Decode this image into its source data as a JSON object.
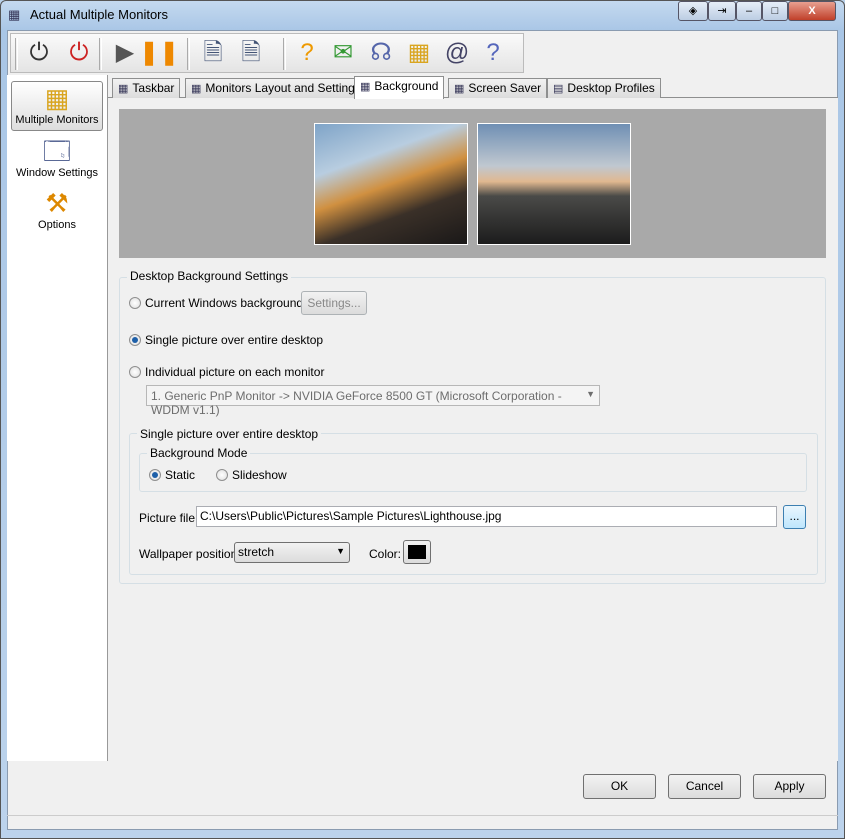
{
  "window": {
    "title": "Actual Multiple Monitors",
    "controls": [
      "◈",
      "⇥",
      "–",
      "□",
      "X"
    ]
  },
  "toolbar": [
    {
      "name": "power-icon",
      "glyph": "⏻",
      "color": "#333"
    },
    {
      "name": "stop-icon",
      "glyph": "⏻",
      "color": "#c22"
    },
    {
      "name": "play-icon",
      "glyph": "▶",
      "color": "#555"
    },
    {
      "name": "pause-icon",
      "glyph": "❚❚",
      "color": "#e80"
    },
    {
      "name": "window-settings-add-icon",
      "glyph": "🗎",
      "color": "#457"
    },
    {
      "name": "window-settings-user-icon",
      "glyph": "🗎",
      "color": "#457"
    },
    {
      "name": "help-document-icon",
      "glyph": "?",
      "color": "#e90"
    },
    {
      "name": "mail-icon",
      "glyph": "✉",
      "color": "#393"
    },
    {
      "name": "support-icon",
      "glyph": "☊",
      "color": "#56a"
    },
    {
      "name": "monitors-icon",
      "glyph": "▦",
      "color": "#d9a520"
    },
    {
      "name": "web-icon",
      "glyph": "@",
      "color": "#446"
    },
    {
      "name": "help-icon",
      "glyph": "?",
      "color": "#56b"
    }
  ],
  "sidebar": {
    "items": [
      {
        "label": "Multiple Monitors",
        "glyph": "▦"
      },
      {
        "label": "Window Settings",
        "glyph": "🗔"
      },
      {
        "label": "Options",
        "glyph": "⚒"
      }
    ]
  },
  "tabs": [
    {
      "label": "Taskbar"
    },
    {
      "label": "Monitors Layout and Settings"
    },
    {
      "label": "Background",
      "active": true
    },
    {
      "label": "Screen Saver"
    },
    {
      "label": "Desktop Profiles"
    }
  ],
  "settings": {
    "group_title": "Desktop Background Settings",
    "opt_current": "Current Windows background",
    "settings_button": "Settings...",
    "opt_single": "Single picture over entire desktop",
    "opt_individual": "Individual picture on each monitor",
    "monitor_select": "1. Generic PnP Monitor -> NVIDIA GeForce 8500 GT (Microsoft Corporation - WDDM v1.1)",
    "selected": "single",
    "single_group_title": "Single picture over entire desktop",
    "mode_group_title": "Background Mode",
    "mode_static": "Static",
    "mode_slideshow": "Slideshow",
    "mode_selected": "static",
    "picture_file_label": "Picture file:",
    "picture_file": "C:\\Users\\Public\\Pictures\\Sample Pictures\\Lighthouse.jpg",
    "browse_button": "...",
    "wallpaper_position_label": "Wallpaper position:",
    "wallpaper_position": "stretch",
    "color_label": "Color:",
    "color_value": "#000000"
  },
  "buttons": {
    "ok": "OK",
    "cancel": "Cancel",
    "apply": "Apply"
  }
}
